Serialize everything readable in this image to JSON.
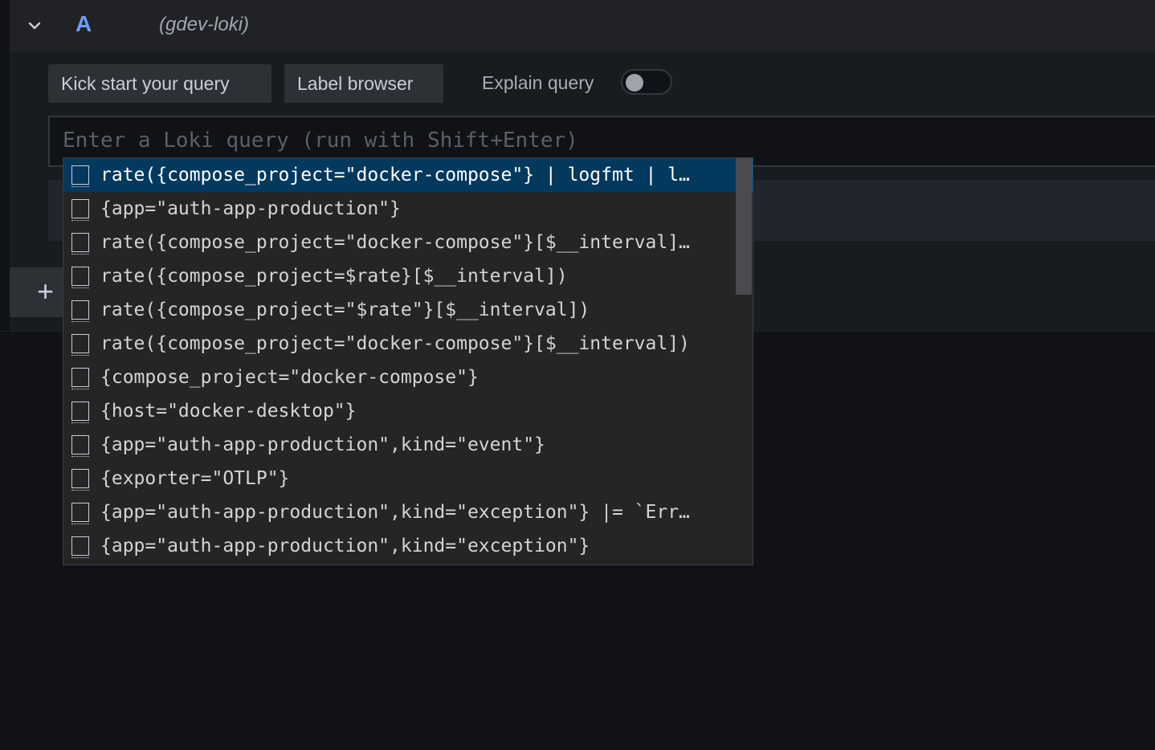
{
  "query_row": {
    "ref_id": "A",
    "datasource": "(gdev-loki)"
  },
  "toolbar": {
    "kick_start_label": "Kick start your query",
    "label_browser_label": "Label browser",
    "explain_query_label": "Explain query",
    "explain_query_enabled": false
  },
  "editor": {
    "placeholder": "Enter a Loki query (run with Shift+Enter)",
    "value": ""
  },
  "add_query": {
    "icon": "plus-icon",
    "icon_glyph": "+"
  },
  "suggestions": {
    "selected_index": 0,
    "items": [
      {
        "label": "rate({compose_project=\"docker-compose\"} | logfmt | l…"
      },
      {
        "label": "{app=\"auth-app-production\"}"
      },
      {
        "label": "rate({compose_project=\"docker-compose\"}[$__interval]…"
      },
      {
        "label": "rate({compose_project=$rate}[$__interval])"
      },
      {
        "label": "rate({compose_project=\"$rate\"}[$__interval])"
      },
      {
        "label": "rate({compose_project=\"docker-compose\"}[$__interval])"
      },
      {
        "label": "{compose_project=\"docker-compose\"}"
      },
      {
        "label": "{host=\"docker-desktop\"}"
      },
      {
        "label": "{app=\"auth-app-production\",kind=\"event\"}"
      },
      {
        "label": "{exporter=\"OTLP\"}"
      },
      {
        "label": "{app=\"auth-app-production\",kind=\"exception\"} |= `Err…"
      },
      {
        "label": "{app=\"auth-app-production\",kind=\"exception\"}"
      }
    ]
  },
  "colors": {
    "background": "#111217",
    "panel": "#181b1f",
    "accent": "#6e9fff",
    "selected_row": "#04395e"
  }
}
